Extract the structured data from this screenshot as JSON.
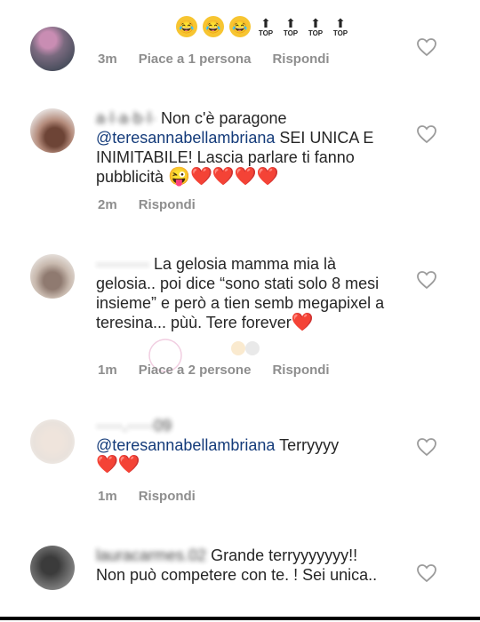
{
  "comment1": {
    "emoji_row": [
      "😂",
      "😂",
      "😂"
    ],
    "top_badges": [
      "TOP",
      "TOP",
      "TOP",
      "TOP"
    ],
    "time": "3m",
    "likes": "Piace a 1 persona",
    "reply": "Rispondi"
  },
  "comment2": {
    "username": "a·l·a·b·l·",
    "text": "Non c'è paragone",
    "mention": "@teresannabellambriana",
    "body": " SEI UNICA E INIMITABILE! Lascia parlare ti fanno pubblicità ",
    "emojis": [
      "😜",
      "❤️",
      "❤️",
      "❤️",
      "❤️"
    ],
    "time": "2m",
    "reply": "Rispondi"
  },
  "comment3": {
    "username": "··········",
    "text": "La gelosia mamma mia là gelosia.. poi dice “sono stati solo 8 mesi insieme” e però a tien semb megapixel a teresina... pùù. Tere forever",
    "emoji": "❤️",
    "time": "1m",
    "likes": "Piace a 2 persone",
    "reply": "Rispondi"
  },
  "comment4": {
    "username": "·····.·····09",
    "mention": "@teresannabellambriana",
    "body": " Terryyyy",
    "emojis": [
      "❤️",
      "❤️"
    ],
    "time": "1m",
    "reply": "Rispondi"
  },
  "comment5": {
    "username": "lauracarmes.02",
    "text": "Grande terryyyyyyy!! Non può competere con te. ! Sei unica.."
  },
  "icons": {
    "like": "heart-outline-icon"
  },
  "colors": {
    "meta": "#8e8e8e",
    "mention": "#143b7a",
    "heart": "#e0112b"
  }
}
